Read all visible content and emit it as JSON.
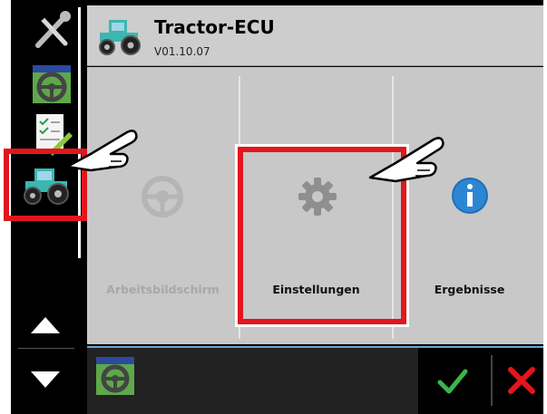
{
  "header": {
    "title": "Tractor-ECU",
    "version": "V01.10.07"
  },
  "sidebar": {
    "items": [
      {
        "name": "settings-tools"
      },
      {
        "name": "working-screen"
      },
      {
        "name": "checklist"
      },
      {
        "name": "tractor-ecu"
      }
    ]
  },
  "tiles": [
    {
      "label": "Arbeitsbildschirm",
      "enabled": false
    },
    {
      "label": "Einstellungen",
      "enabled": true
    },
    {
      "label": "Ergebnisse",
      "enabled": true
    }
  ],
  "colors": {
    "accent_red": "#e2161d",
    "confirm_green": "#3bb54a",
    "cancel_red": "#e2161d",
    "tractor_teal": "#3cb7b0"
  }
}
